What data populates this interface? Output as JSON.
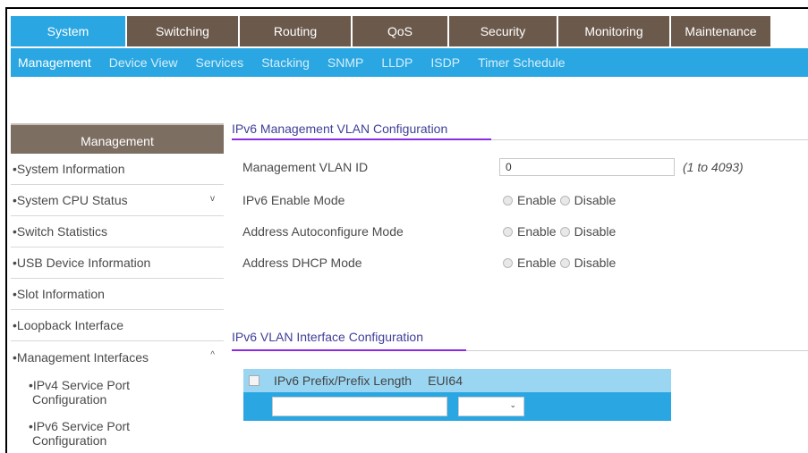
{
  "topnav": {
    "tabs": [
      {
        "label": "System",
        "active": true
      },
      {
        "label": "Switching",
        "active": false
      },
      {
        "label": "Routing",
        "active": false
      },
      {
        "label": "QoS",
        "active": false
      },
      {
        "label": "Security",
        "active": false
      },
      {
        "label": "Monitoring",
        "active": false
      },
      {
        "label": "Maintenance",
        "active": false
      }
    ]
  },
  "subnav": {
    "items": [
      "Management",
      "Device View",
      "Services",
      "Stacking",
      "SNMP",
      "LLDP",
      "ISDP",
      "Timer Schedule"
    ]
  },
  "sidebar": {
    "heading": "Management",
    "items": [
      {
        "label": "System Information"
      },
      {
        "label": "System CPU Status",
        "chevron": "v"
      },
      {
        "label": "Switch Statistics"
      },
      {
        "label": "USB Device Information"
      },
      {
        "label": "Slot Information"
      },
      {
        "label": "Loopback Interface"
      },
      {
        "label": "Management Interfaces",
        "chevron": "^"
      }
    ],
    "subitems": [
      {
        "line1": "IPv4 Service Port",
        "line2": "Configuration"
      },
      {
        "line1": "IPv6 Service Port",
        "line2": "Configuration"
      }
    ]
  },
  "mgmt_vlan": {
    "title": "IPv6 Management VLAN Configuration",
    "vlan_id_label": "Management VLAN ID",
    "vlan_id_value": "0",
    "vlan_id_hint": "(1 to 4093)",
    "enable_mode_label": "IPv6 Enable Mode",
    "autoconf_label": "Address Autoconfigure Mode",
    "dhcp_label": "Address DHCP Mode",
    "enable_text": "Enable",
    "disable_text": "Disable"
  },
  "vlan_iface": {
    "title": "IPv6 VLAN Interface Configuration",
    "col_prefix": "IPv6 Prefix/Prefix Length",
    "col_eui": "EUI64",
    "new_prefix_value": "",
    "new_eui_value": ""
  },
  "colors": {
    "accent": "#2aa7e2",
    "tab_bg": "#6b5a4c",
    "sidebar_head": "#7d6e62",
    "section_title": "#3f3f9a",
    "section_accent": "#8a2be2"
  }
}
